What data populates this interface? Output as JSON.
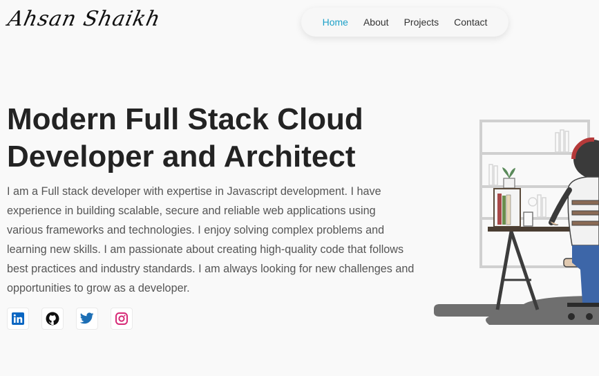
{
  "header": {
    "logo_text": "Ahsan Shaikh",
    "nav": [
      {
        "label": "Home"
      },
      {
        "label": "About"
      },
      {
        "label": "Projects"
      },
      {
        "label": "Contact"
      }
    ],
    "active_nav": "Home"
  },
  "hero": {
    "title_line1": "Modern Full Stack Cloud",
    "title_line2": "Developer and Architect",
    "description": "I am a Full stack developer with expertise in Javascript development. I have experience in building scalable, secure and reliable web applications using various frameworks and technologies. I enjoy solving complex problems and learning new skills. I am passionate about creating high-quality code that follows best practices and industry standards. I am always looking for new challenges and opportunities to grow as a developer."
  },
  "socials": [
    {
      "icon": "linkedin-icon",
      "color": "#0a66c2"
    },
    {
      "icon": "github-icon",
      "color": "#111111"
    },
    {
      "icon": "twitter-icon",
      "color": "#1d6fb5"
    },
    {
      "icon": "instagram-icon",
      "color": "#d62976"
    }
  ],
  "colors": {
    "accent": "#1da1c8",
    "background": "#f9f9f9",
    "text": "#232323"
  }
}
